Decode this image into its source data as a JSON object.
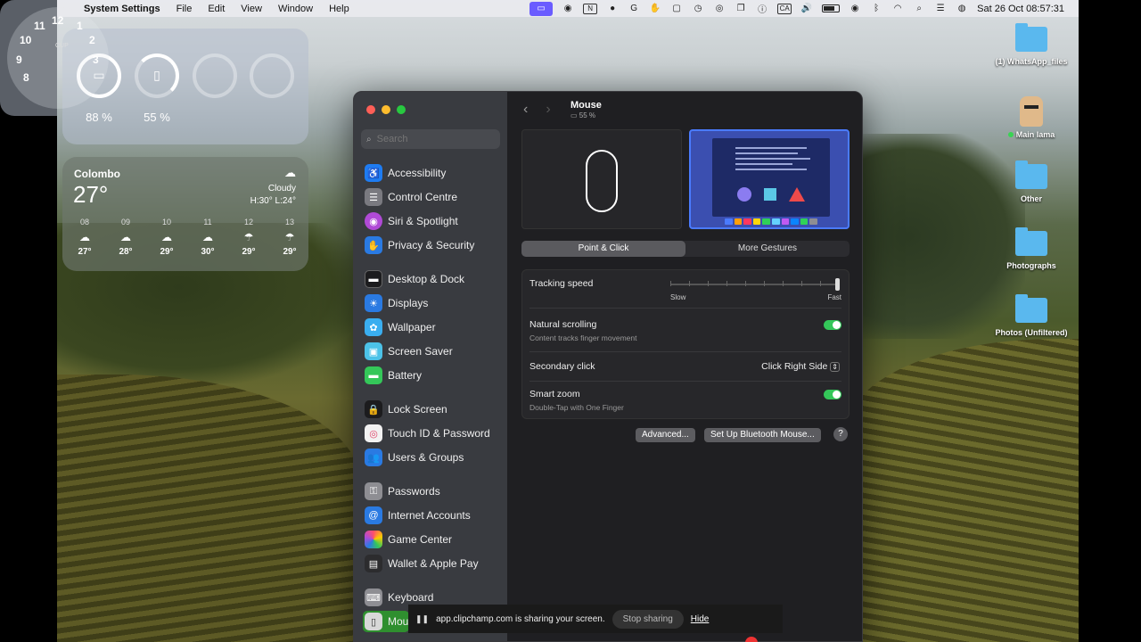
{
  "menubar": {
    "app_name": "System Settings",
    "menus": [
      "File",
      "Edit",
      "View",
      "Window",
      "Help"
    ],
    "status_icons": {
      "s0": "CA"
    },
    "datetime": "Sat 26 Oct  08:57:31"
  },
  "widgets": {
    "battery": {
      "laptop_pct": "88 %",
      "mouse_pct": "55 %"
    },
    "clock": {
      "label": "CUP",
      "numbers": [
        "12",
        "1",
        "2",
        "3",
        "8",
        "9",
        "10",
        "11"
      ]
    },
    "weather": {
      "city": "Colombo",
      "temp": "27°",
      "condition": "Cloudy",
      "hilo": "H:30° L:24°",
      "forecast": [
        {
          "hour": "08",
          "temp": "27°"
        },
        {
          "hour": "09",
          "temp": "28°"
        },
        {
          "hour": "10",
          "temp": "29°"
        },
        {
          "hour": "11",
          "temp": "30°"
        },
        {
          "hour": "12",
          "temp": "29°"
        },
        {
          "hour": "13",
          "temp": "29°"
        }
      ]
    }
  },
  "desktop_icons": {
    "i0": "(1) WhatsApp_files",
    "i1": "Main lama",
    "i2": "Other",
    "i3": "Photographs",
    "i4": "Photos (Unfiltered)"
  },
  "sidebar": {
    "search_placeholder": "Search",
    "items": [
      {
        "label": "Accessibility",
        "icon": "accessibility-icon",
        "color": "#1e7cf2"
      },
      {
        "label": "Control Centre",
        "icon": "control-centre-icon",
        "color": "#7a7a80"
      },
      {
        "label": "Siri & Spotlight",
        "icon": "siri-icon",
        "color": "#b04ad6"
      },
      {
        "label": "Privacy & Security",
        "icon": "hand-icon",
        "color": "#2a7ae2"
      },
      {
        "label": "Desktop & Dock",
        "icon": "dock-icon",
        "color": "#1c1c1e"
      },
      {
        "label": "Displays",
        "icon": "sun-icon",
        "color": "#2a7ae2"
      },
      {
        "label": "Wallpaper",
        "icon": "flower-icon",
        "color": "#3aaef0"
      },
      {
        "label": "Screen Saver",
        "icon": "screen-saver-icon",
        "color": "#4cc2e8"
      },
      {
        "label": "Battery",
        "icon": "battery-icon",
        "color": "#34c759"
      },
      {
        "label": "Lock Screen",
        "icon": "lock-icon",
        "color": "#1c1c1e"
      },
      {
        "label": "Touch ID & Password",
        "icon": "fingerprint-icon",
        "color": "#f2f2f2"
      },
      {
        "label": "Users & Groups",
        "icon": "users-icon",
        "color": "#2a7ae2"
      },
      {
        "label": "Passwords",
        "icon": "key-icon",
        "color": "#8e8e93"
      },
      {
        "label": "Internet Accounts",
        "icon": "at-icon",
        "color": "#2a7ae2"
      },
      {
        "label": "Game Center",
        "icon": "game-center-icon",
        "color": "#e8e8e8"
      },
      {
        "label": "Wallet & Apple Pay",
        "icon": "wallet-icon",
        "color": "#2c2c2e"
      },
      {
        "label": "Keyboard",
        "icon": "keyboard-icon",
        "color": "#8e8e93"
      },
      {
        "label": "Mou",
        "icon": "mouse-icon",
        "color": "#d8d8d8"
      }
    ]
  },
  "main": {
    "title": "Mouse",
    "subtitle": "55 %",
    "tabs": [
      "Point & Click",
      "More Gestures"
    ],
    "active_tab": 0,
    "settings": {
      "tracking_speed": {
        "label": "Tracking speed",
        "min_label": "Slow",
        "max_label": "Fast",
        "value": 1.0
      },
      "natural_scrolling": {
        "label": "Natural scrolling",
        "desc": "Content tracks finger movement",
        "on": true
      },
      "secondary_click": {
        "label": "Secondary click",
        "value": "Click Right Side"
      },
      "smart_zoom": {
        "label": "Smart zoom",
        "desc": "Double-Tap with One Finger",
        "on": true
      }
    },
    "buttons": {
      "advanced": "Advanced...",
      "setup": "Set Up Bluetooth Mouse...",
      "help": "?"
    }
  },
  "sharing": {
    "message": "app.clipchamp.com is sharing your screen.",
    "stop_label": "Stop sharing",
    "hide_label": "Hide"
  },
  "colors": {
    "accent": "#34c759",
    "selection": "#2f8f2f"
  }
}
